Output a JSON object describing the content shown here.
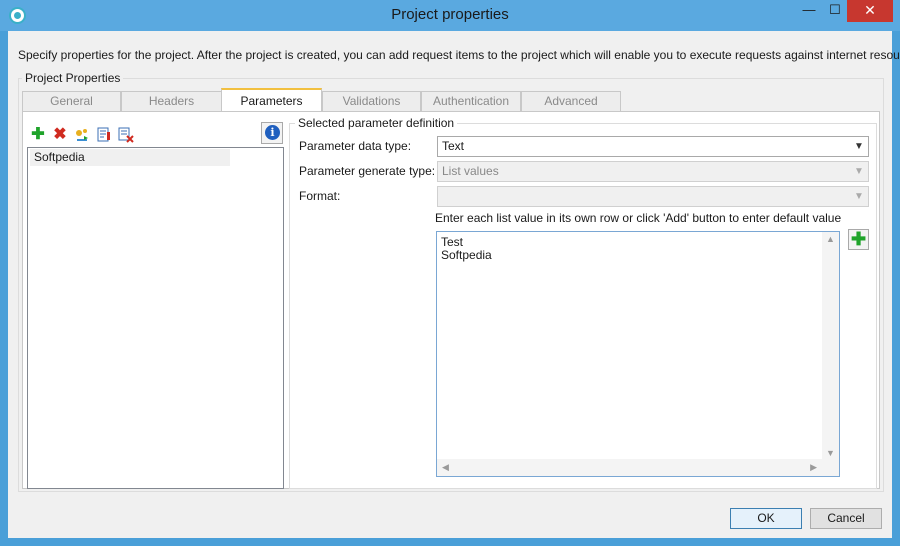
{
  "window": {
    "title": "Project properties",
    "minimize_glyph": "—",
    "maximize_glyph": "☐",
    "close_glyph": "✕",
    "accent_color": "#5aa9e0"
  },
  "intro_text": "Specify properties for the project. After the project is created, you can add request items to the project which will enable you to execute requests against internet resources.",
  "group": {
    "label": "Project Properties"
  },
  "tabs": [
    {
      "label": "General",
      "active": false
    },
    {
      "label": "Headers",
      "active": false
    },
    {
      "label": "Parameters",
      "active": true
    },
    {
      "label": "Validations",
      "active": false
    },
    {
      "label": "Authentication",
      "active": false
    },
    {
      "label": "Advanced",
      "active": false
    }
  ],
  "toolbar": {
    "add_icon": "add-icon",
    "delete_icon": "delete-icon",
    "generate_icon": "generate-icon",
    "properties_icon": "properties-icon",
    "clear_icon": "clear-icon",
    "info_glyph": "i"
  },
  "parameters": {
    "items": [
      "Softpedia"
    ]
  },
  "definition": {
    "label": "Selected parameter definition",
    "data_type_label": "Parameter data type:",
    "data_type_value": "Text",
    "generate_type_label": "Parameter generate type:",
    "generate_type_value": "List values",
    "format_label": "Format:",
    "format_value": "",
    "hint": "Enter each list value in its own row or click 'Add' button to enter default value",
    "list_values": [
      "Test",
      "Softpedia"
    ]
  },
  "buttons": {
    "ok": "OK",
    "cancel": "Cancel"
  }
}
